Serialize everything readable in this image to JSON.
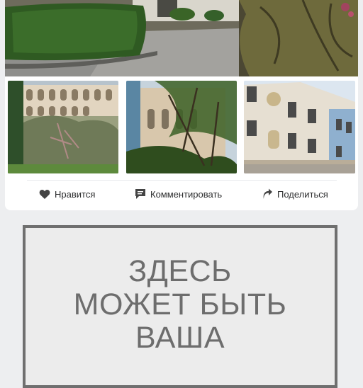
{
  "post": {
    "photos": {
      "main": "courtyard-with-hedges",
      "thumbnails": [
        "building-with-arches",
        "tree-and-facade",
        "ornate-facade"
      ]
    },
    "actions": {
      "like_label": "Нравится",
      "comment_label": "Комментировать",
      "share_label": "Поделиться"
    }
  },
  "ad_placeholder": {
    "lines": [
      "ЗДЕСЬ",
      "МОЖЕТ БЫТЬ",
      "ВАША"
    ]
  },
  "colors": {
    "page_background": "#edeef0",
    "card_background": "#ffffff",
    "text": "#2c2d2e",
    "icon": "#444444",
    "ad_border": "#6f6f6f",
    "ad_text": "#6d6d6d"
  }
}
